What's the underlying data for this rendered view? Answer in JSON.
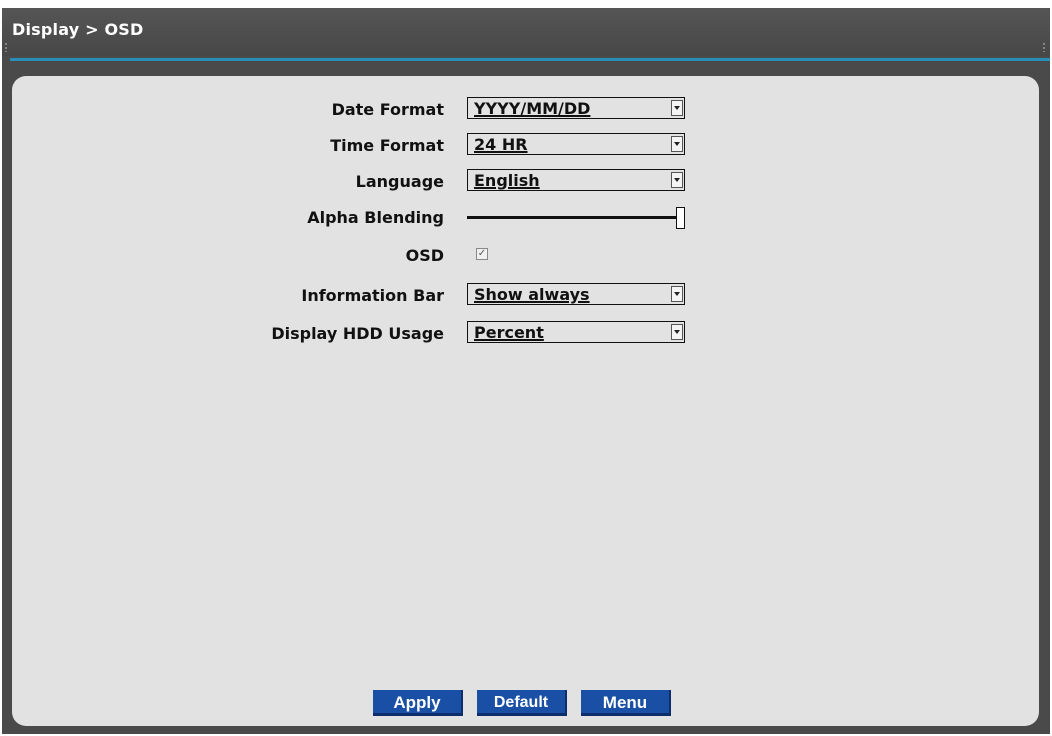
{
  "window": {
    "title": "Display > OSD"
  },
  "form": {
    "date_format": {
      "label": "Date Format",
      "value": "YYYY/MM/DD"
    },
    "time_format": {
      "label": "Time Format",
      "value": "24 HR"
    },
    "language": {
      "label": "Language",
      "value": "English"
    },
    "alpha_blending": {
      "label": "Alpha Blending",
      "level": 1.0
    },
    "osd": {
      "label": "OSD",
      "checked": true
    },
    "information_bar": {
      "label": "Information Bar",
      "value": "Show always"
    },
    "display_hdd_usage": {
      "label": "Display HDD Usage",
      "value": "Percent"
    }
  },
  "buttons": {
    "apply": "Apply",
    "default": "Default",
    "menu": "Menu"
  },
  "colors": {
    "titlebar": "#4a4a4a",
    "accent": "#2a8db5",
    "panel": "#e2e2e2",
    "button": "#1a4fa6"
  }
}
